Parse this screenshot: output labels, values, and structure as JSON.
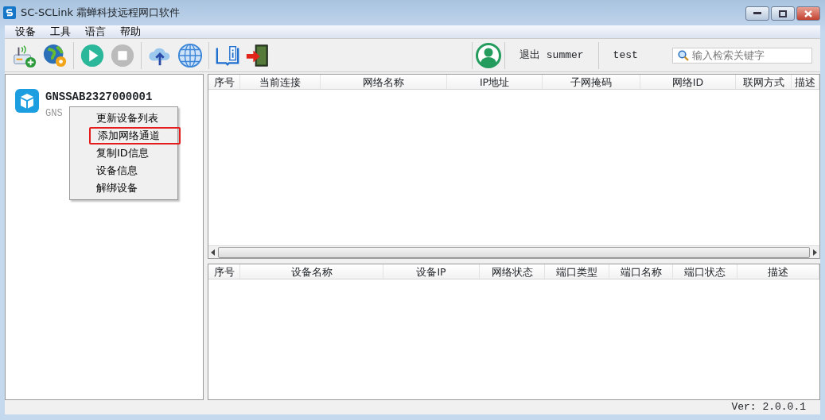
{
  "window": {
    "title": "SC-SCLink 霜蝉科技远程网口软件"
  },
  "menu": [
    "设备",
    "工具",
    "语言",
    "帮助"
  ],
  "toolbar": {
    "groups": [
      [
        {
          "kind": "router"
        },
        {
          "kind": "globe-gear"
        }
      ],
      [
        {
          "kind": "play"
        },
        {
          "kind": "stop"
        }
      ],
      [
        {
          "kind": "upload"
        },
        {
          "kind": "globe"
        }
      ],
      [
        {
          "kind": "book"
        },
        {
          "kind": "exit"
        }
      ]
    ]
  },
  "user": {
    "logout": "退出 summer",
    "account": "test"
  },
  "search": {
    "placeholder": "输入检索关键字"
  },
  "devices": [
    {
      "name": "GNSSAB2327000001",
      "subtitle": "GNS"
    }
  ],
  "context_menu": [
    {
      "label": "更新设备列表",
      "selected": false
    },
    {
      "label": "添加网络通道",
      "selected": true
    },
    {
      "label": "复制ID信息",
      "selected": false
    },
    {
      "label": "设备信息",
      "selected": false
    },
    {
      "label": "解绑设备",
      "selected": false
    }
  ],
  "channel_table": {
    "columns": [
      "序号",
      "当前连接",
      "网络名称",
      "IP地址",
      "子网掩码",
      "网络ID",
      "联网方式",
      "描述"
    ]
  },
  "port_table": {
    "columns": [
      "序号",
      "设备名称",
      "设备IP",
      "网络状态",
      "端口类型",
      "端口名称",
      "端口状态",
      "描述"
    ]
  },
  "status_bar": {
    "version": "Ver: 2.0.0.1"
  }
}
